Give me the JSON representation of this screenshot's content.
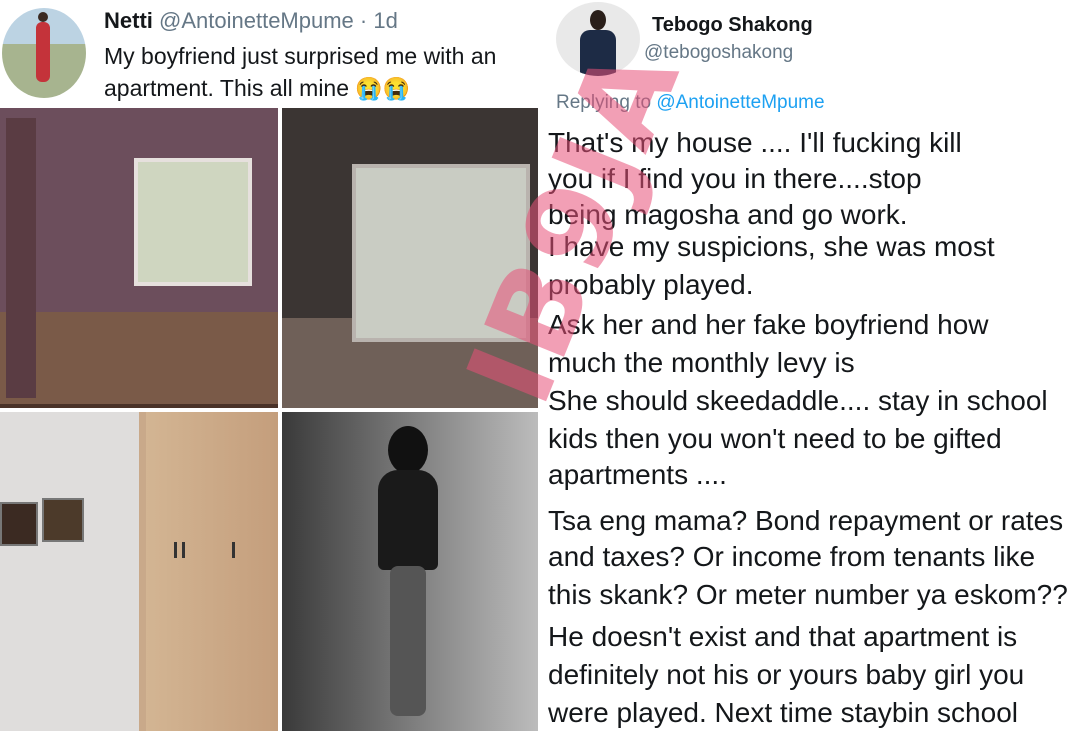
{
  "tweet1": {
    "name": "Netti",
    "handle": "@AntoinetteMpume",
    "time": "· 1d",
    "text": "My boyfriend just surprised me with an apartment. This all mine",
    "emoji": "😭😭"
  },
  "tweet2": {
    "name": "Tebogo Shakong",
    "handle": "@tebogoshakong",
    "replying_prefix": "Replying to",
    "replying_to": "@AntoinetteMpume",
    "lines": [
      "That's my house .... I'll fucking kill",
      "you  if I find you in there....stop",
      "being magosha and go work.",
      "I have my suspicions, she was most",
      "probably played.",
      "Ask her and her fake boyfriend how",
      "much the monthly levy is",
      "She should skeedaddle.... stay in school",
      "kids then you won't need to be gifted",
      "apartments ....",
      "Tsa eng mama? Bond repayment or rates",
      "and taxes? Or income from tenants like",
      "this skank? Or meter number ya eskom??",
      "He doesn't exist and that apartment is",
      "definitely not his or yours baby girl you",
      "were played. Next time staybin school"
    ]
  },
  "watermark": "IB9JA"
}
